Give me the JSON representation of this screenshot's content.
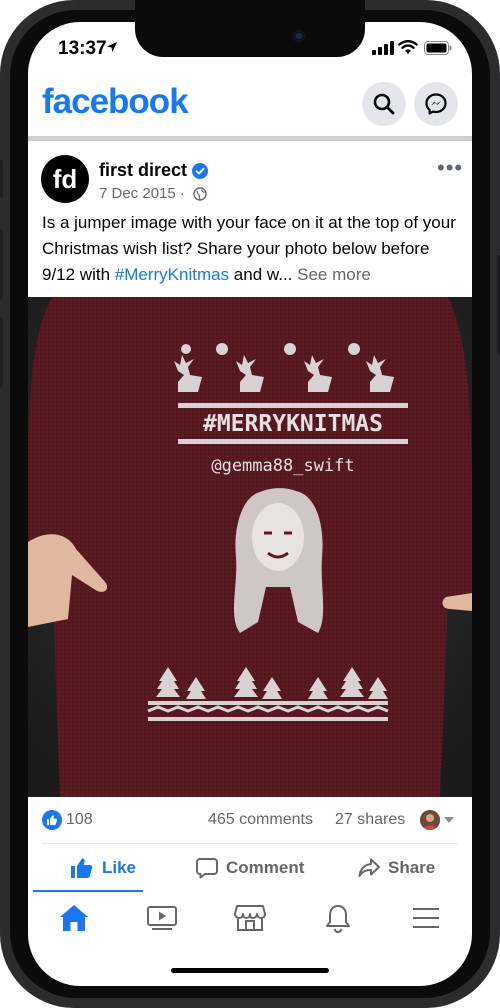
{
  "status_bar": {
    "time": "13:37"
  },
  "header": {
    "logo_text": "facebook",
    "search_icon": "search-icon",
    "messenger_icon": "messenger-icon"
  },
  "post": {
    "avatar_text": "fd",
    "page_name": "first direct",
    "date": "7 Dec 2015 ·",
    "text_before": "Is a jumper image with your face on it at the top of your Christmas wish list? Share your photo below before 9/12 with ",
    "hashtag": "#MerryKnitmas",
    "text_after": " and w... ",
    "see_more": "See more",
    "image": {
      "hashtag_text": "#MERRYKNITMAS",
      "handle_text": "@gemma88_swift"
    }
  },
  "stats": {
    "likes": "108",
    "comments": "465 comments",
    "shares": "27 shares"
  },
  "actions": {
    "like": "Like",
    "comment": "Comment",
    "share": "Share"
  },
  "nav": {
    "tabs": [
      "home-icon",
      "watch-icon",
      "marketplace-icon",
      "notifications-icon",
      "menu-icon"
    ]
  },
  "colors": {
    "brand": "#1877F2",
    "sweater": "#5a1a22"
  }
}
